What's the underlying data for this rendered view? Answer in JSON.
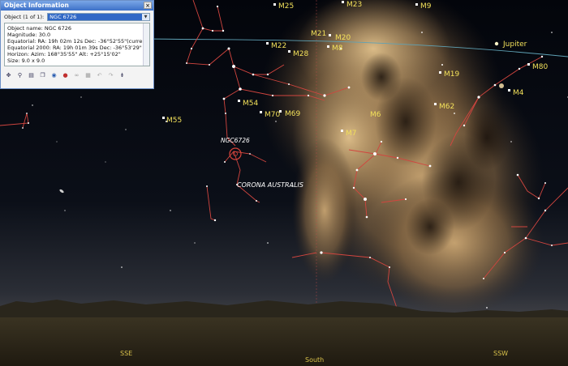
{
  "panel": {
    "title": "Object Information",
    "close": "×",
    "object_label": "Object (1 of 1):",
    "object_selected": "NGC 6726",
    "info_lines": [
      "Object name: NGC 6726",
      "Magnitude: 30.0",
      "Equatorial: RA: 19h 02m 12s   Dec: -36°52'55\"(current)",
      "Equatorial 2000: RA: 19h 01m 39s   Dec: -36°53'29\"",
      "Horizon: Azim: 168°35'55\"   Alt: +25°15'02\"",
      "Size: 9.0 x 9.0"
    ],
    "toolbar_icons": [
      "move-icon",
      "binoculars-icon",
      "print-icon",
      "copy-icon",
      "web-icon",
      "image-icon",
      "link-icon",
      "grid-icon",
      "undo-icon",
      "redo-icon",
      "expand-icon"
    ]
  },
  "sky": {
    "labels": {
      "m25": "M25",
      "m23": "M23",
      "m9": "M9",
      "m21": "M21",
      "m20": "M20",
      "m22": "M22",
      "m8": "M8",
      "jupiter": "Jupiter",
      "m28": "M28",
      "m80": "M80",
      "m19": "M19",
      "m4": "M4",
      "m54": "M54",
      "m62": "M62",
      "m70": "M70",
      "m69": "M69",
      "m6": "M6",
      "m55": "M55",
      "m7": "M7",
      "ngc6726": "NGC6726",
      "corona": "CORONA AUSTRALIS"
    },
    "cardinal": {
      "sse": "SSE",
      "south": "South",
      "ssw": "SSW"
    }
  }
}
